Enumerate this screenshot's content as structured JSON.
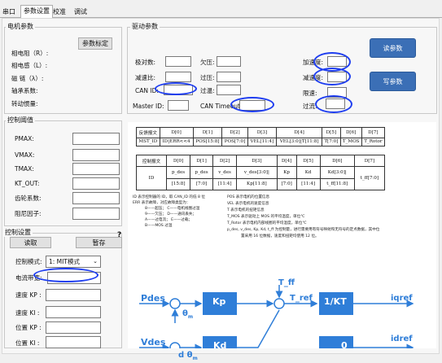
{
  "tabs": [
    "串口",
    "参数设置",
    "校准",
    "调试"
  ],
  "motor": {
    "title": "电机参数",
    "calib_button": "参数标定",
    "fields": [
      "相电阻（R）:",
      "相电感（L）:",
      "磁 链（λ）:",
      "轴承系数:",
      "转动惯量:"
    ]
  },
  "drive": {
    "title": "驱动参数",
    "left_fields": [
      "极对数:",
      "减速比:",
      "CAN ID:",
      "Master ID:"
    ],
    "mid_fields": [
      "欠压:",
      "过压:",
      "过温:",
      "CAN Timeout:"
    ],
    "right_fields": [
      "加速度:",
      "减速度:",
      "限速:",
      "过流:"
    ],
    "read_button": "读参数",
    "write_button": "写参数"
  },
  "threshold": {
    "title": "控制阈值",
    "fields": [
      "PMAX:",
      "VMAX:",
      "TMAX:",
      "KT_OUT:",
      "齿轮系数:",
      "阻尼因子:"
    ]
  },
  "control": {
    "title": "控制设置",
    "read_button": "读取",
    "pause_button": "暂存",
    "help": "?",
    "mode_label": "控制模式:",
    "mode_value": "1: MIT模式",
    "current_bw_label": "电流带宽:",
    "fields": [
      "速度 KP :",
      "速度 KI :",
      "位置 KP :",
      "位置 KI :"
    ]
  },
  "diagram": {
    "feedback_header": [
      "反馈报文",
      "D[0]",
      "D[1]",
      "D[2]",
      "D[3]",
      "D[4]",
      "D[5]",
      "D[6]",
      "D[7]"
    ],
    "feedback_row": [
      "MST_ID",
      "ID|ERR<<4",
      "POS[15:8]",
      "POS[7:0]",
      "VEL[11:4]",
      "VEL[3:0]|T[11:8]",
      "T[7:0]",
      "T_MOS",
      "T_Rotor"
    ],
    "control_header": [
      "控制报文",
      "D[0]",
      "D[1]",
      "D[2]",
      "D[3]",
      "D[4]",
      "D[5]",
      "D[6]",
      "D[7]"
    ],
    "control_row1": [
      "ID",
      "p_des",
      "p_des",
      "v_des",
      "v_des[3:0]|",
      "Kp",
      "Kd",
      "Kd[3:0]|",
      "t_ff[7:0]"
    ],
    "control_row2": [
      "",
      "[15:8]",
      "[7:0]",
      "[11:4]",
      "Kp[11:8]",
      "[7:0]",
      "[11:4]",
      "t_ff[11:8]",
      ""
    ],
    "left_notes": [
      "ID 表示控制器的 ID，取 CAN_ID 的低 8 位",
      "ERR 表示故障，对应故障类型为：",
      "8——超压；    C——电机线圈过温",
      "9——欠压；    D——通讯丢失；",
      "A——过电流；  E——过载；",
      "B——MOS 过温"
    ],
    "right_notes": [
      "POS 表示电机的位置信息",
      "VEL 表示电机的速度信息",
      "T 表示电机的扭矩信息",
      "T_MOS 表示驱动上 MOS 的平均温度，单位℃",
      "T_Rotor 表示电机内部线圈的平均温度，单位℃",
      "p_des, v_des, Kp, Kd, t_ff 为控制量，进行需要用有符号映射和无符号的定点数据，其中位",
      "置采用 16 位数据，速度和扭矩均使用 12 位。"
    ],
    "pdes": "Pdes",
    "theta_m": "θ",
    "theta_sub": "m",
    "kp": "Kp",
    "t_ff": "T_ff",
    "t_ref": "T_ref",
    "inv_kt": "1/KT",
    "iqref": "iqref",
    "vdes": "Vdes",
    "dtheta": "d θ",
    "dtheta_sub": "m",
    "kd": "Kd",
    "zero": "0",
    "idref": "idref"
  },
  "colors": {
    "blue_box": "#3b6fb6",
    "diagram_blue": "#2f7ed8",
    "annotation": "#1f3ef0"
  }
}
